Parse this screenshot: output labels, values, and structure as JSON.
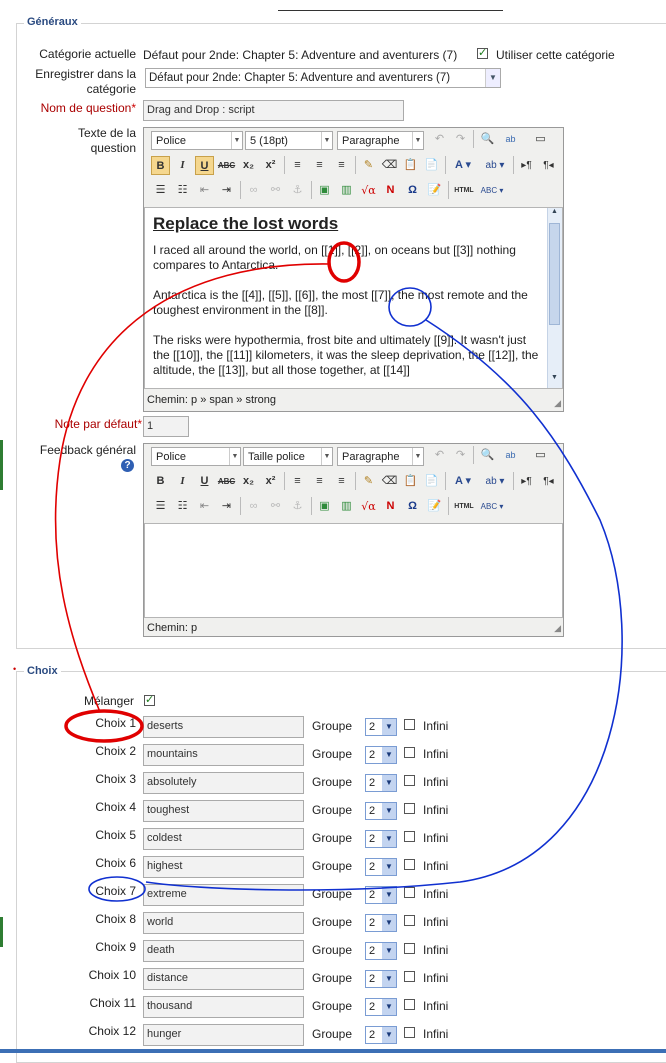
{
  "sections": {
    "generaux": "Généraux",
    "choix": "Choix"
  },
  "categorie_actuelle": {
    "label": "Catégorie actuelle",
    "value": "Défaut pour 2nde: Chapter 5: Adventure and aventurers (7)",
    "use_label": "Utiliser cette catégorie"
  },
  "enregistrer": {
    "label_1": "Enregistrer dans la",
    "label_2": "catégorie",
    "value": "Défaut pour 2nde: Chapter 5: Adventure and aventurers (7)"
  },
  "nom_question": {
    "label": "Nom de question",
    "value": "Drag and Drop : script"
  },
  "texte_question": {
    "label_1": "Texte de la",
    "label_2": "question"
  },
  "editor1": {
    "font": "Police",
    "size": "5 (18pt)",
    "format": "Paragraphe",
    "heading": "Replace the lost words",
    "p1": "I raced all around the world, on [[1]], [[2]], on oceans but [[3]] nothing compares to Antarctica.",
    "p2": "Antarctica is the [[4]], [[5]], [[6]], the most [[7]], the most remote and the toughest environment in the [[8]].",
    "p3": "The risks were hypothermia, frost bite and ultimately [[9]]. It wasn't just the  [[10]], the [[11]] kilometers, it was the sleep deprivation, the [[12]], the altitude, the [[13]], but all those together, at [[14]]",
    "path": "Chemin: p » span » strong"
  },
  "note": {
    "label": "Note par défaut",
    "value": "1"
  },
  "feedback": {
    "label": "Feedback général"
  },
  "editor2": {
    "font": "Police",
    "size": "Taille police",
    "format": "Paragraphe",
    "path": "Chemin: p"
  },
  "toolbar": {
    "html": "HTML",
    "abc": "ABC"
  },
  "melanger": {
    "label": "Mélanger"
  },
  "choices": [
    {
      "label": "Choix 1",
      "value": "deserts",
      "groupe": "Groupe",
      "group_value": "2",
      "infini": "Infini"
    },
    {
      "label": "Choix 2",
      "value": "mountains",
      "groupe": "Groupe",
      "group_value": "2",
      "infini": "Infini"
    },
    {
      "label": "Choix 3",
      "value": "absolutely",
      "groupe": "Groupe",
      "group_value": "2",
      "infini": "Infini"
    },
    {
      "label": "Choix 4",
      "value": "toughest",
      "groupe": "Groupe",
      "group_value": "2",
      "infini": "Infini"
    },
    {
      "label": "Choix 5",
      "value": "coldest",
      "groupe": "Groupe",
      "group_value": "2",
      "infini": "Infini"
    },
    {
      "label": "Choix 6",
      "value": "highest",
      "groupe": "Groupe",
      "group_value": "2",
      "infini": "Infini"
    },
    {
      "label": "Choix 7",
      "value": "extreme",
      "groupe": "Groupe",
      "group_value": "2",
      "infini": "Infini"
    },
    {
      "label": "Choix 8",
      "value": "world",
      "groupe": "Groupe",
      "group_value": "2",
      "infini": "Infini"
    },
    {
      "label": "Choix 9",
      "value": "death",
      "groupe": "Groupe",
      "group_value": "2",
      "infini": "Infini"
    },
    {
      "label": "Choix 10",
      "value": "distance",
      "groupe": "Groupe",
      "group_value": "2",
      "infini": "Infini"
    },
    {
      "label": "Choix 11",
      "value": "thousand",
      "groupe": "Groupe",
      "group_value": "2",
      "infini": "Infini"
    },
    {
      "label": "Choix 12",
      "value": "hunger",
      "groupe": "Groupe",
      "group_value": "2",
      "infini": "Infini"
    }
  ],
  "colors": {
    "legend": "#2a4a80",
    "required": "#a00000",
    "annotation_red": "#e00000",
    "annotation_blue": "#1030d0"
  }
}
